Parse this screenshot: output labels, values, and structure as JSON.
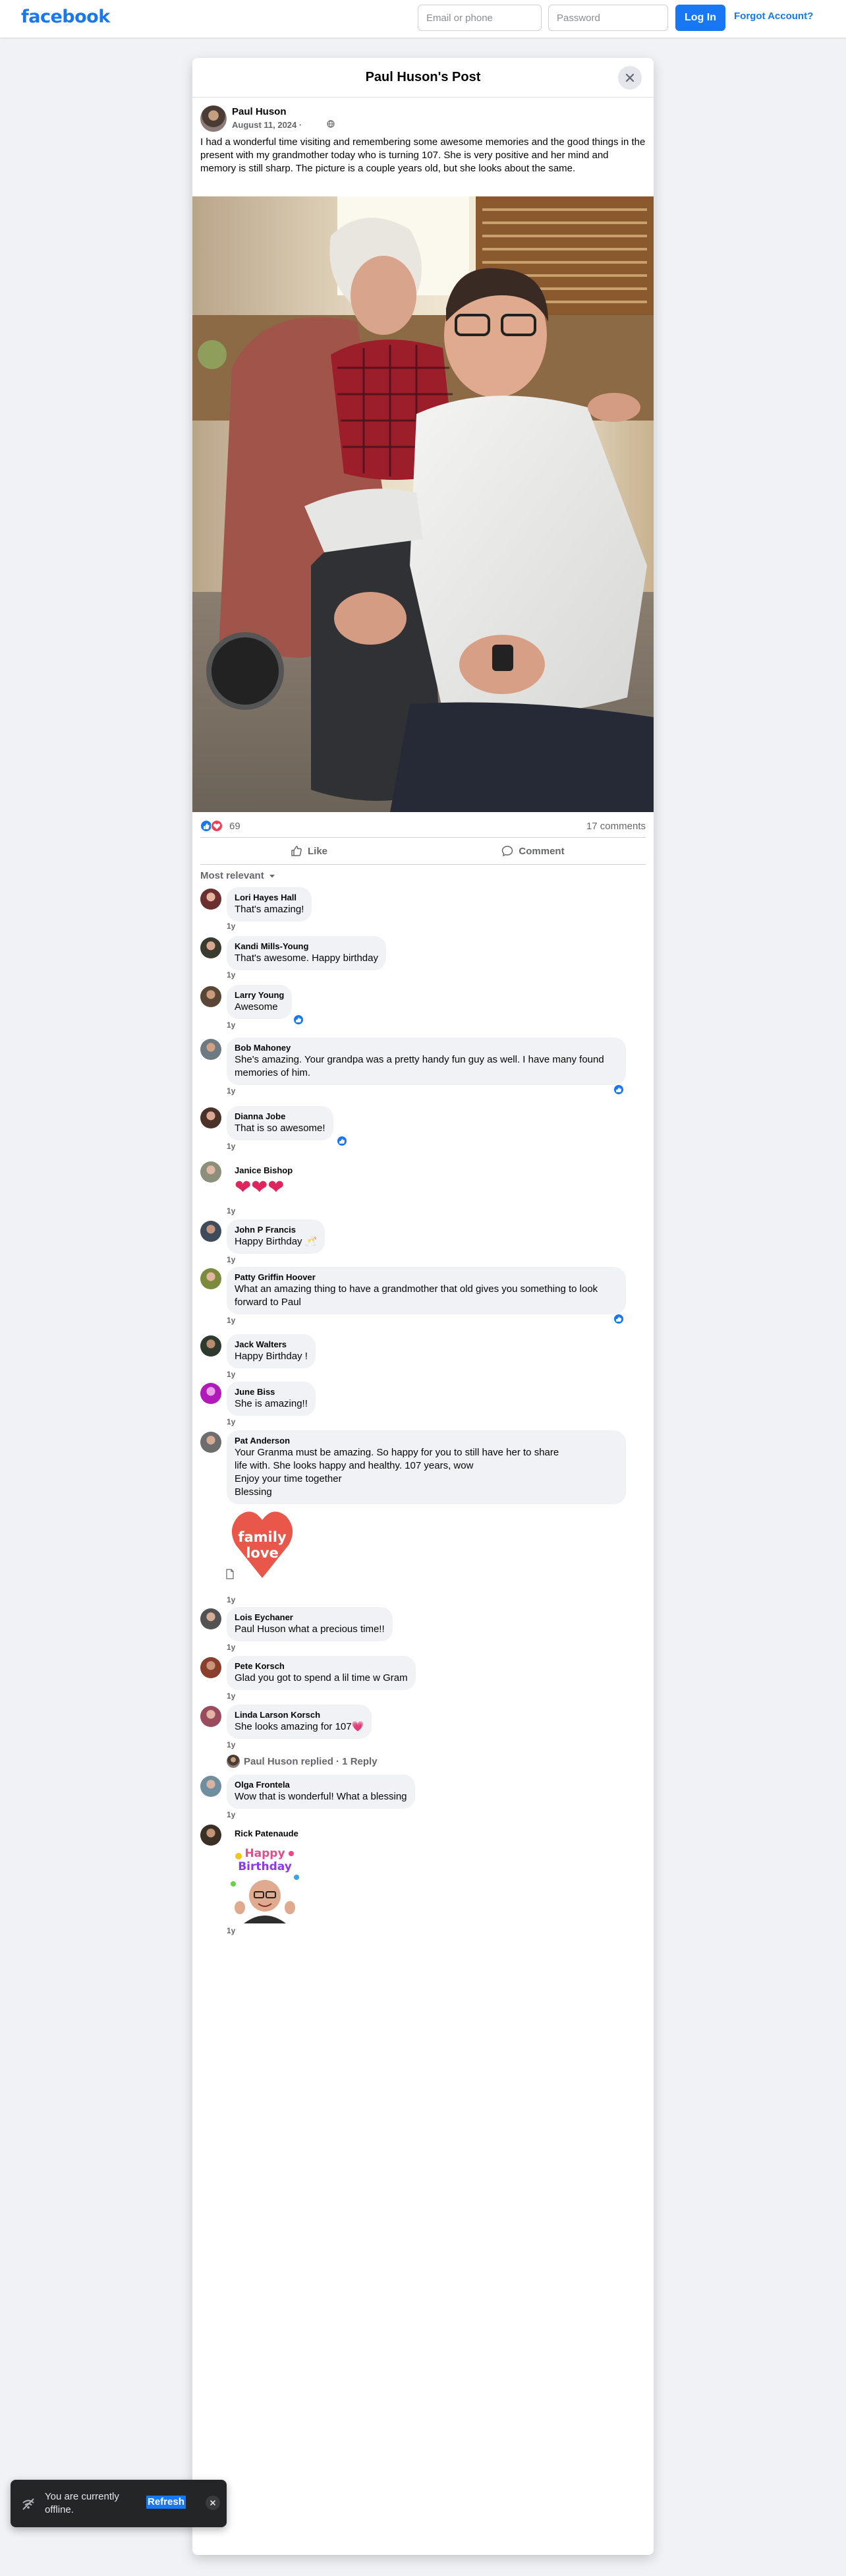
{
  "topbar": {
    "logo": "facebook",
    "email_placeholder": "Email or phone",
    "password_placeholder": "Password",
    "login_label": "Log In",
    "forgot_label": "Forgot Account?"
  },
  "dialog": {
    "title": "Paul Huson's Post"
  },
  "post": {
    "author": "Paul Huson",
    "date": "August 11, 2024 ·",
    "text": "I had a wonderful time visiting and remembering some awesome memories and the good things in the present with my grandmother today who is turning 107.  She is very positive and her mind and memory is still sharp.  The picture is a couple years old, but she looks about the same.",
    "reaction_count": "69",
    "comment_count": "17 comments",
    "like_label": "Like",
    "comment_label": "Comment",
    "sort_label": "Most relevant"
  },
  "comments": [
    {
      "name": "Lori Hayes Hall",
      "text": "That's amazing!",
      "time": "1y"
    },
    {
      "name": "Kandi Mills-Young",
      "text": "That's awesome. Happy birthday",
      "time": "1y"
    },
    {
      "name": "Larry Young",
      "text": "Awesome",
      "time": "1y"
    },
    {
      "name": "Bob Mahoney",
      "text": "She's amazing. Your grandpa was a pretty handy fun guy as well. I have many found memories of him.",
      "time": "1y"
    },
    {
      "name": "Dianna Jobe",
      "text": "That is so awesome!",
      "time": "1y"
    },
    {
      "name": "Janice Bishop",
      "text": "❤❤❤",
      "time": "1y"
    },
    {
      "name": "John P Francis",
      "text": "Happy Birthday 🥂",
      "time": "1y"
    },
    {
      "name": "Patty Griffin Hoover",
      "text": "What an amazing thing to have a grandmother that old gives you something to look forward to Paul",
      "time": "1y"
    },
    {
      "name": "Jack Walters",
      "text": "Happy Birthday !",
      "time": "1y"
    },
    {
      "name": "June Biss",
      "text": "She is amazing!!",
      "time": "1y"
    },
    {
      "name": "Pat Anderson",
      "text_lines": [
        "Your Granma must be amazing. So happy for you to still have her to share",
        "life with. She looks happy and healthy. 107 years, wow",
        "Enjoy your time together",
        "Blessing"
      ],
      "sticker_text": [
        "family",
        "love"
      ],
      "time": "1y"
    },
    {
      "name": "Lois Eychaner",
      "text": "Paul Huson what a precious time!!",
      "time": "1y"
    },
    {
      "name": "Pete Korsch",
      "text": "Glad you got to spend a lil time w Gram",
      "time": "1y"
    },
    {
      "name": "Linda Larson Korsch",
      "text": "She looks amazing for 107💗",
      "time": "1y"
    },
    {
      "name": "Olga Frontela",
      "text": "Wow that is wonderful! What a blessing",
      "time": "1y"
    },
    {
      "name": "Rick Patenaude",
      "sticker_text": [
        "Happy",
        "Birthday"
      ],
      "time": "1y"
    }
  ],
  "replied": {
    "label": "Paul Huson replied · 1 Reply"
  },
  "toast": {
    "text": "You are currently offline.",
    "refresh_label": "Refresh"
  },
  "colors": {
    "brand": "#1877f2",
    "page_bg": "#f0f2f5",
    "bubble_bg": "#f0f2f5",
    "secondary_text": "#65676b"
  }
}
